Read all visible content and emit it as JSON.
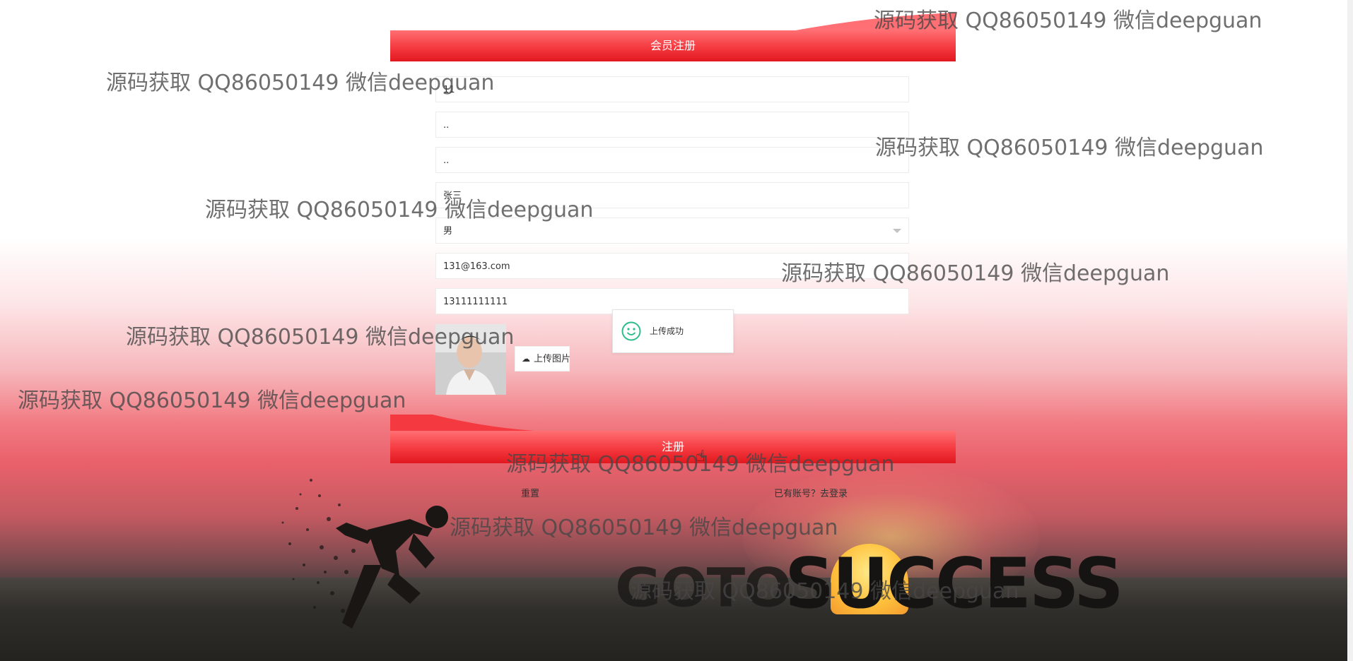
{
  "header": {
    "title": "会员注册"
  },
  "form": {
    "fields": [
      {
        "name": "account",
        "value": "11"
      },
      {
        "name": "password",
        "value": ".."
      },
      {
        "name": "confirm_password",
        "value": ".."
      },
      {
        "name": "real_name",
        "value": "张三"
      },
      {
        "name": "gender",
        "value": "男"
      },
      {
        "name": "email",
        "value": "131@163.com"
      },
      {
        "name": "phone",
        "value": "13111111111"
      }
    ],
    "upload_label": "上传图片",
    "toast_message": "上传成功",
    "submit_label": "注册",
    "reset_label": "重置",
    "login_link": "已有账号？去登录"
  },
  "background": {
    "logo_word_1": "GOTO",
    "logo_word_2": "SUCCESS"
  },
  "watermark": {
    "text": "源码获取 QQ86050149 微信deepguan"
  },
  "colors": {
    "accent_red": "#f43a40",
    "toast_smile": "#2dbd8b"
  }
}
